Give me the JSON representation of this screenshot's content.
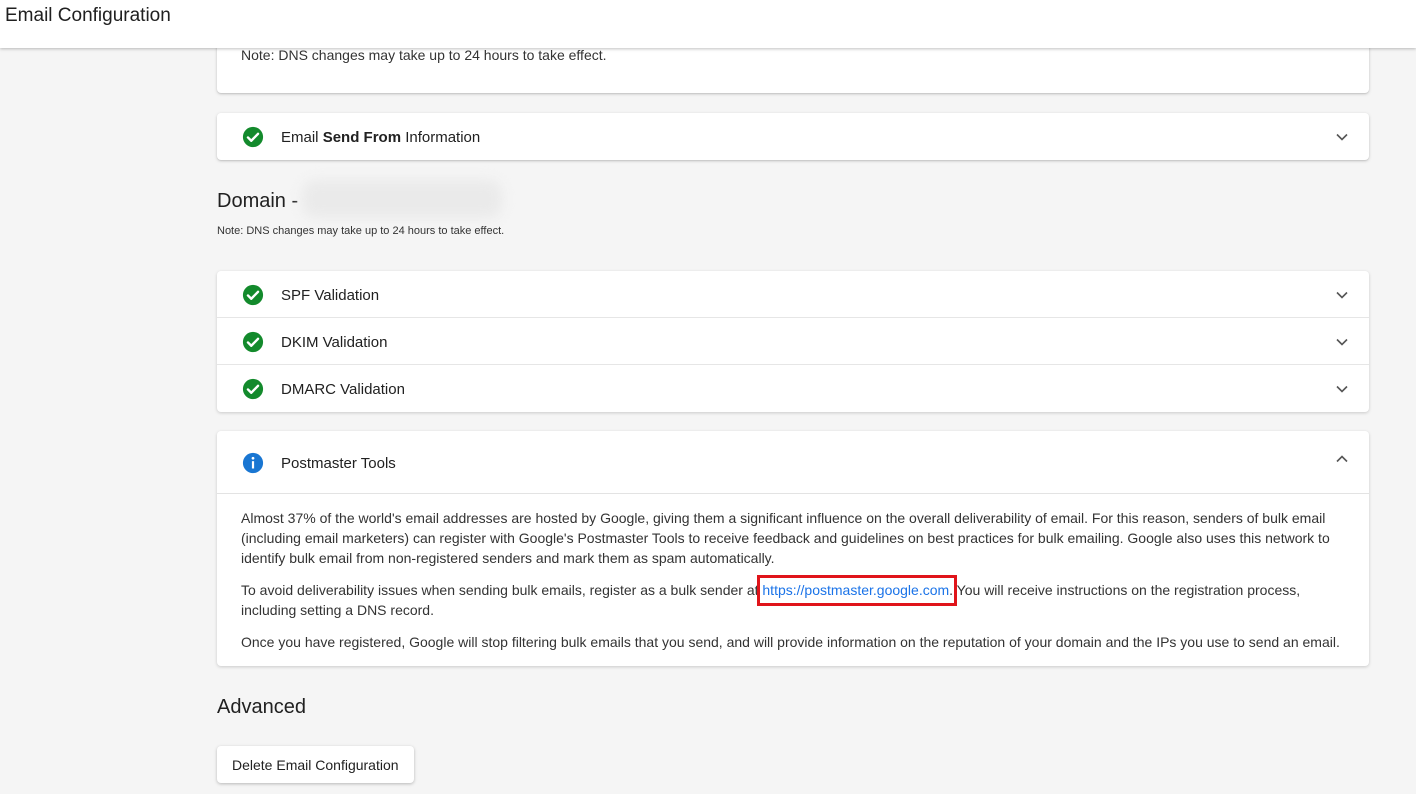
{
  "header": {
    "title": "Email Configuration"
  },
  "top_card": {
    "note": "Note: DNS changes may take up to 24 hours to take effect."
  },
  "send_from": {
    "label_pre": "Email ",
    "label_bold": "Send From",
    "label_post": " Information",
    "icon": "check-circle-icon",
    "status": "success"
  },
  "domain": {
    "heading": "Domain -",
    "note": "Note: DNS changes may take up to 24 hours to take effect."
  },
  "validations": [
    {
      "label": "SPF Validation",
      "icon": "check-circle-icon"
    },
    {
      "label": "DKIM Validation",
      "icon": "check-circle-icon"
    },
    {
      "label": "DMARC Validation",
      "icon": "check-circle-icon"
    }
  ],
  "postmaster": {
    "label": "Postmaster Tools",
    "icon": "info-circle-icon",
    "expanded": true,
    "para1": "Almost 37% of the world's email addresses are hosted by Google, giving them a significant influence on the overall deliverability of email. For this reason, senders of bulk email (including email marketers) can register with Google's Postmaster Tools to receive feedback and guidelines on best practices for bulk emailing. Google also uses this network to identify bulk email from non-registered senders and mark them as spam automatically.",
    "para2_pre": "To avoid deliverability issues when sending bulk emails, register as a bulk sender at",
    "link_text": "https://postmaster.google.com",
    "para2_post": ". You will receive instructions on the registration process, including setting a DNS record.",
    "para3": "Once you have registered, Google will stop filtering bulk emails that you send, and will provide information on the reputation of your domain and the IPs you use to send an email."
  },
  "advanced": {
    "heading": "Advanced",
    "delete_button": "Delete Email Configuration"
  },
  "colors": {
    "success": "#138a2c",
    "info": "#1976d2",
    "link": "#1a73e8",
    "highlight": "#e0141a"
  }
}
